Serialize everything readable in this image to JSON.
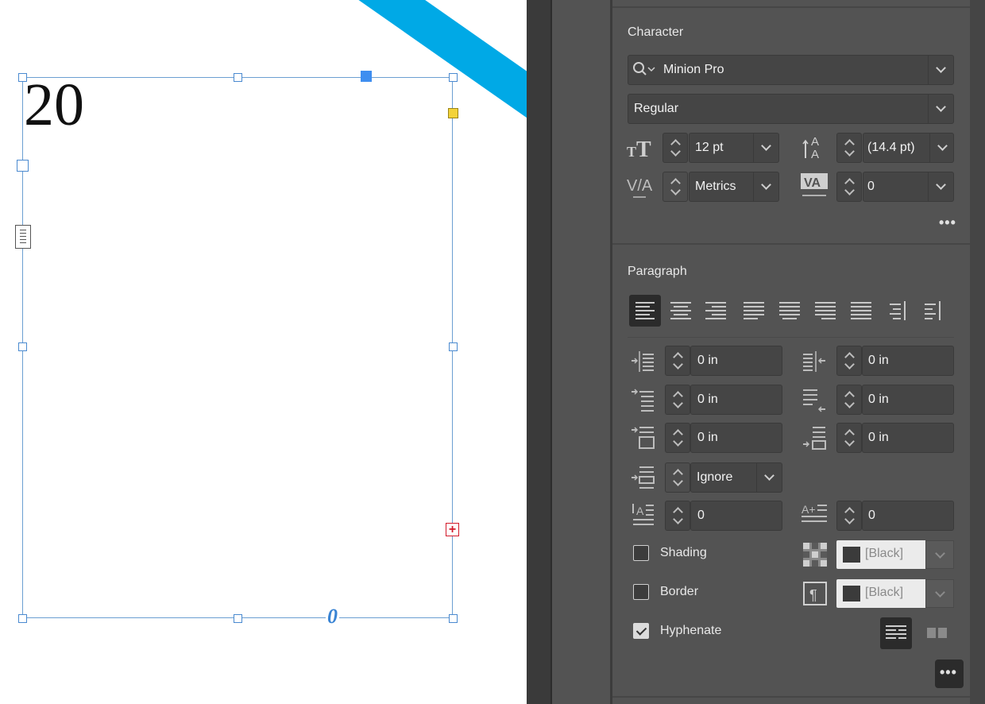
{
  "canvas": {
    "page_number": "20",
    "out_port_glyph": "0",
    "overset_glyph": "+"
  },
  "character": {
    "title": "Character",
    "font_family": "Minion Pro",
    "font_style": "Regular",
    "font_size": "12 pt",
    "leading": "(14.4 pt)",
    "kerning": "Metrics",
    "tracking": "0",
    "more": "•••"
  },
  "paragraph": {
    "title": "Paragraph",
    "alignments": [
      "align-left",
      "align-center",
      "align-right",
      "justify-last-left",
      "justify-last-center",
      "justify-last-right",
      "justify-all",
      "align-towards-spine",
      "align-away-from-spine"
    ],
    "left_indent": "0 in",
    "right_indent": "0 in",
    "first_line_indent": "0 in",
    "last_line_indent": "0 in",
    "space_before": "0 in",
    "space_after": "0 in",
    "align_to_grid": "Ignore",
    "drop_cap_lines": "0",
    "drop_cap_chars": "0",
    "shading_label": "Shading",
    "shading_color": "[Black]",
    "border_label": "Border",
    "border_color": "[Black]",
    "hyphenate_label": "Hyphenate",
    "hyphenate_checked": true,
    "more": "•••"
  },
  "colors": {
    "accent_blue": "#00a9e6",
    "selection": "#4a8ad0",
    "panel_bg": "#535353",
    "field_bg": "#454545"
  }
}
